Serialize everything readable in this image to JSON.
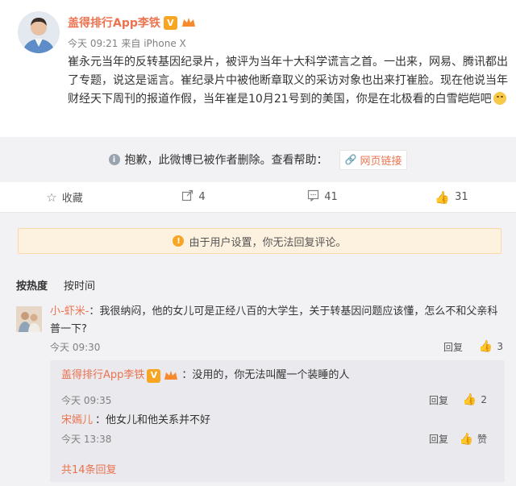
{
  "post": {
    "author": "盖得排行App李铁",
    "verified_badge": "V",
    "time": "今天 09:21",
    "source": "来自 iPhone X",
    "text": "崔永元当年的反转基因纪录片，被评为当年十大科学谎言之首。一出来，网易、腾讯都出了专题，说这是谣言。崔纪录片中被他断章取义的采访对象也出来打崔脸。现在他说当年财经天下周刊的报道作假，当年崔是10月21号到的美国，你是在北极看的白雪皑皑吧"
  },
  "deleted_notice": {
    "text": "抱歉，此微博已被作者删除。查看帮助：",
    "link_label": "网页链接"
  },
  "actions": {
    "favorite": "收藏",
    "repost": "4",
    "comment": "41",
    "like": "31"
  },
  "comment_notice": "由于用户设置，你无法回复评论。",
  "sort": {
    "hot": "按热度",
    "time": "按时间"
  },
  "comment": {
    "user": "小-虾米-",
    "text": "：我很纳闷，他的女儿可是正经八百的大学生，关于转基因问题应该懂，怎么不和父亲科普一下?",
    "time": "今天 09:30",
    "reply_label": "回复",
    "likes": "3"
  },
  "replies": [
    {
      "user": "盖得排行App李铁",
      "badge": "V",
      "text": "：没用的，你无法叫醒一个装睡的人",
      "time": "今天 09:35",
      "reply_label": "回复",
      "likes": "2"
    },
    {
      "user": "宋嫣儿",
      "text": "：他女儿和他关系并不好",
      "time": "今天 13:38",
      "reply_label": "回复",
      "likes": "赞"
    }
  ],
  "more_replies": "共14条回复",
  "colors": {
    "link": "#eb7350",
    "badge": "#f6a623",
    "panel": "#f2f2f5"
  }
}
